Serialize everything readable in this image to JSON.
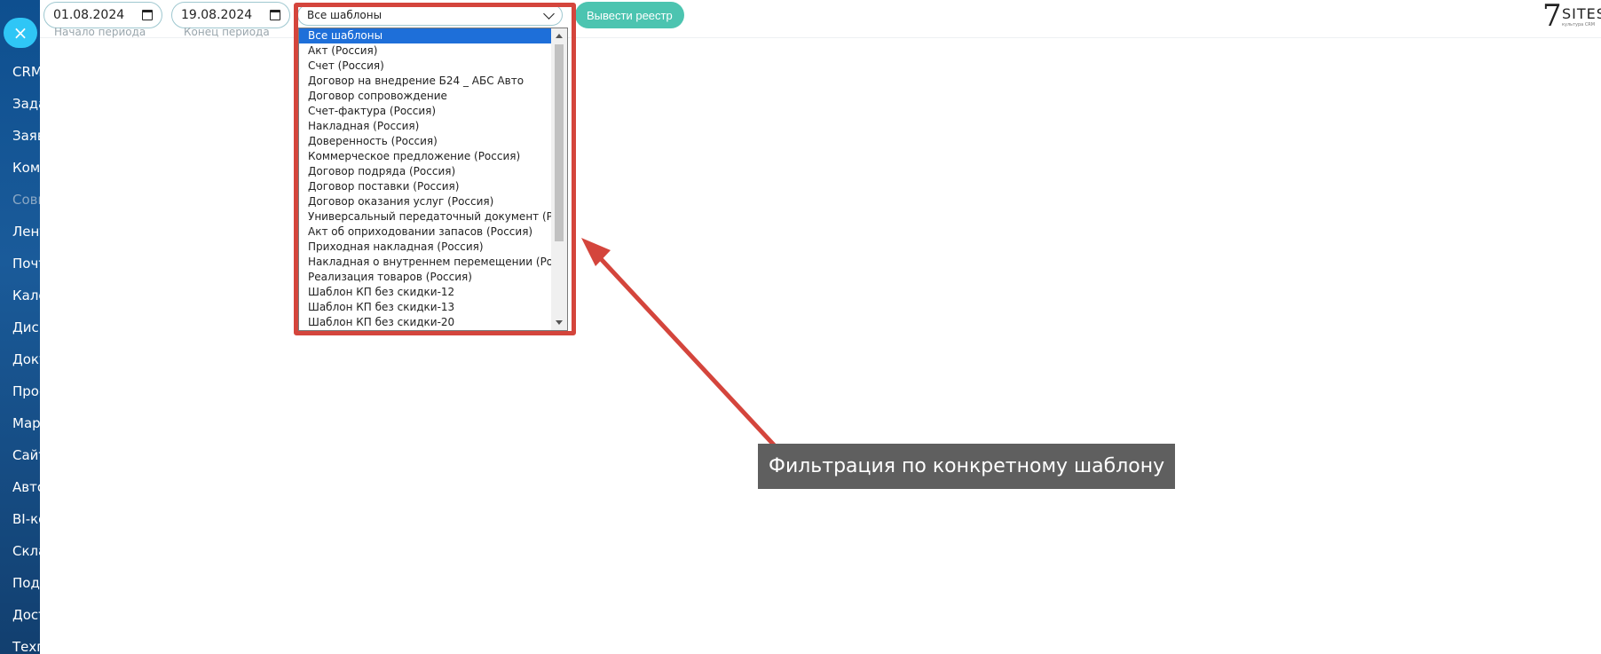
{
  "sidebar": {
    "items": [
      "CRM",
      "Задачи",
      "Заявки",
      "Компания",
      "Совместная",
      "Лента",
      "Почта",
      "Календарь",
      "Диск",
      "Документы",
      "Проекты",
      "Маркетинг",
      "Сайты",
      "Автоматизация",
      "BI-конструктор",
      "Склад",
      "Подписки",
      "Доставка",
      "Техподдержка"
    ],
    "close_icon": "×"
  },
  "filters": {
    "start_date": "01.08.2024",
    "start_caption": "Начало периода",
    "end_date": "19.08.2024",
    "end_caption": "Конец периода",
    "template_selected": "Все шаблоны",
    "report_button": "Вывести реестр"
  },
  "logo": {
    "mark": "7",
    "text": "SITES",
    "sub": "культура CRM"
  },
  "dropdown": {
    "options": [
      "Все шаблоны",
      "Акт (Россия)",
      "Счет (Россия)",
      "Договор на внедрение Б24 _ АБС Авто",
      "Договор сопровождение",
      "Счет-фактура (Россия)",
      "Накладная (Россия)",
      "Доверенность (Россия)",
      "Коммерческое предложение (Россия)",
      "Договор подряда (Россия)",
      "Договор поставки (Россия)",
      "Договор оказания услуг (Россия)",
      "Универсальный передаточный документ (Россия)",
      "Акт об оприходовании запасов (Россия)",
      "Приходная накладная (Россия)",
      "Накладная о внутреннем перемещении (Россия)",
      "Реализация товаров (Россия)",
      "Шаблон КП без скидки-12",
      "Шаблон КП без скидки-13",
      "Шаблон КП без скидки-20"
    ],
    "selected_index": 0
  },
  "annotation": {
    "callout_text": "Фильтрация по конкретному шаблону",
    "color": "#d4453c"
  },
  "colors": {
    "accent_button": "#4cc4b0",
    "close_button": "#2fc6f6",
    "selected_option": "#1e6fd9"
  }
}
